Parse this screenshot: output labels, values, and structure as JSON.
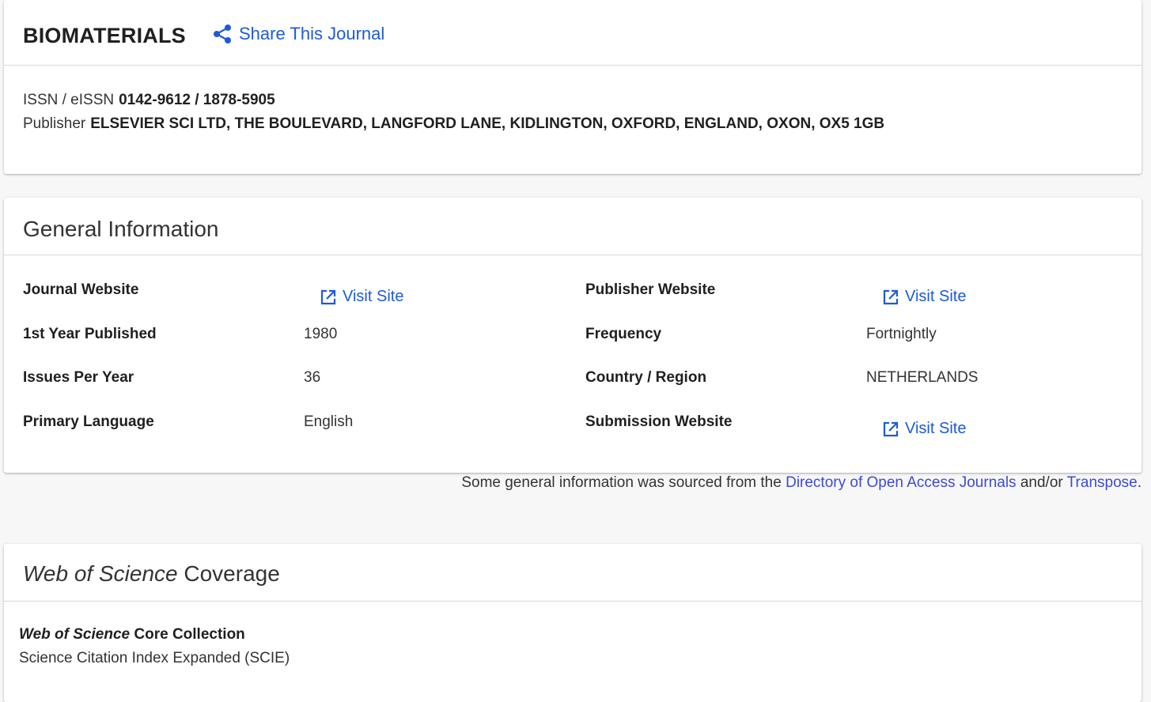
{
  "journal": {
    "title": "BIOMATERIALS",
    "share_label": "Share This Journal",
    "issn_label": "ISSN / eISSN",
    "issn_value": "0142-9612 / 1878-5905",
    "publisher_label": "Publisher",
    "publisher_value": "ELSEVIER SCI LTD, THE BOULEVARD, LANGFORD LANE, KIDLINGTON, OXFORD, ENGLAND, OXON, OX5 1GB"
  },
  "general": {
    "title": "General Information",
    "visit_label": "Visit Site",
    "rows": [
      {
        "label": "Journal Website",
        "value": ""
      },
      {
        "label": "1st Year Published",
        "value": "1980"
      },
      {
        "label": "Issues Per Year",
        "value": "36"
      },
      {
        "label": "Primary Language",
        "value": "English"
      },
      {
        "label": "Publisher Website",
        "value": ""
      },
      {
        "label": "Frequency",
        "value": "Fortnightly"
      },
      {
        "label": "Country / Region",
        "value": "NETHERLANDS"
      },
      {
        "label": "Submission Website",
        "value": ""
      }
    ]
  },
  "source_note": {
    "prefix": "Some general information was sourced from the ",
    "link1": "Directory of Open Access Journals",
    "middle": " and/or ",
    "link2": "Transpose",
    "suffix": "."
  },
  "coverage": {
    "title_italic": "Web of Science",
    "title_rest": " Coverage",
    "collection_italic": "Web of Science",
    "collection_rest": " Core Collection",
    "index_name": "Science Citation Index Expanded (SCIE)"
  },
  "colors": {
    "link": "#1c5bd8",
    "note_link": "#3b4bd6",
    "background": "#f7f7f7"
  }
}
